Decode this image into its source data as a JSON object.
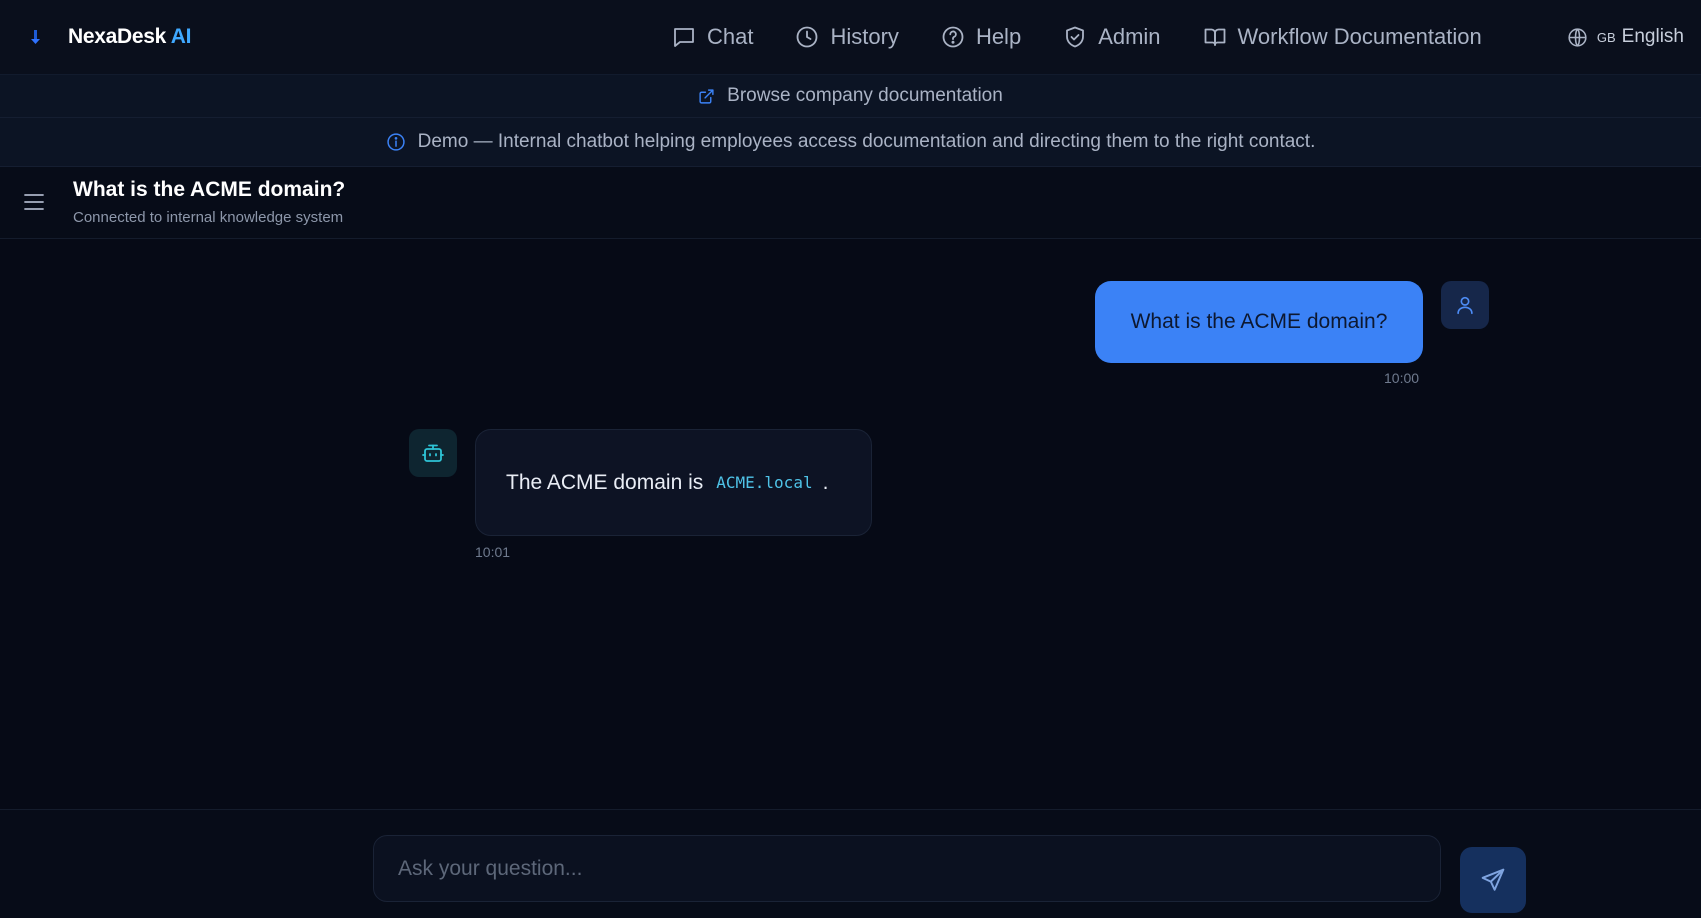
{
  "brand": {
    "name": "NexaDesk",
    "suffix": "AI"
  },
  "nav": {
    "items": [
      {
        "label": "Chat",
        "icon": "chat-bubble-icon"
      },
      {
        "label": "History",
        "icon": "clock-icon"
      },
      {
        "label": "Help",
        "icon": "help-circle-icon"
      },
      {
        "label": "Admin",
        "icon": "shield-check-icon"
      },
      {
        "label": "Workflow Documentation",
        "icon": "book-open-icon"
      }
    ],
    "language": {
      "flag": "GB",
      "label": "English",
      "icon": "globe-icon"
    }
  },
  "banner": {
    "doc_link": "Browse company documentation",
    "info": "Demo — Internal chatbot helping employees access documentation and directing them to the right contact."
  },
  "chat": {
    "title": "What is the ACME domain?",
    "subtitle": "Connected to internal knowledge system",
    "messages": [
      {
        "role": "user",
        "text": "What is the ACME domain?",
        "time": "10:00"
      },
      {
        "role": "bot",
        "text_before": "The ACME domain is",
        "code": "ACME.local",
        "text_after": ".",
        "time": "10:01"
      }
    ]
  },
  "input": {
    "placeholder": "Ask your question..."
  },
  "colors": {
    "accent": "#3b82f6",
    "brand_ai": "#3fa8ff",
    "code": "#4fc3e8",
    "background": "#060a16"
  }
}
